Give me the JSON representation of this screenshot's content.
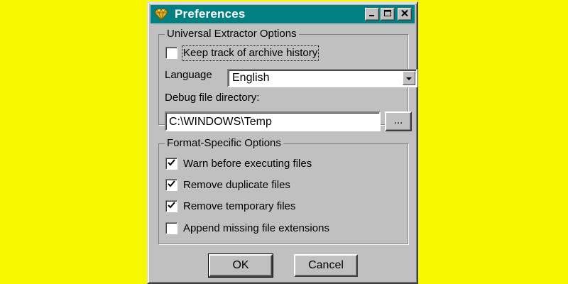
{
  "window": {
    "title": "Preferences"
  },
  "group_general": {
    "title": "Universal Extractor Options",
    "history": {
      "label": "Keep track of archive history",
      "checked": false
    },
    "language": {
      "label": "Language",
      "value": "English"
    },
    "debug": {
      "label": "Debug file directory:",
      "value": "C:\\WINDOWS\\Temp",
      "browse_label": "..."
    }
  },
  "group_format": {
    "title": "Format-Specific Options",
    "options": [
      {
        "label": "Warn before executing files",
        "checked": true
      },
      {
        "label": "Remove duplicate files",
        "checked": true
      },
      {
        "label": "Remove temporary files",
        "checked": true
      },
      {
        "label": "Append missing file extensions",
        "checked": false
      }
    ]
  },
  "buttons": {
    "ok": "OK",
    "cancel": "Cancel"
  },
  "colors": {
    "background": "#f7f700",
    "titlebar": "#008080",
    "face": "#c0c0c0"
  },
  "icons": {
    "app": "gem-icon",
    "minimize": "minimize-icon",
    "maximize": "maximize-icon",
    "close": "close-icon",
    "dropdown": "chevron-down-icon"
  }
}
